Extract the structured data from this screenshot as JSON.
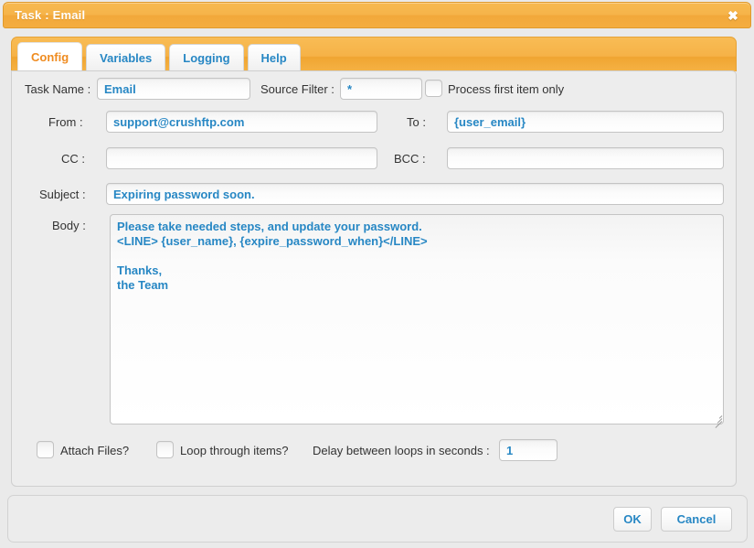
{
  "window": {
    "title": "Task : Email",
    "close_icon": "close-icon",
    "close_glyph": "✖"
  },
  "tabs": [
    {
      "label": "Config",
      "active": true
    },
    {
      "label": "Variables",
      "active": false
    },
    {
      "label": "Logging",
      "active": false
    },
    {
      "label": "Help",
      "active": false
    }
  ],
  "form": {
    "task_name": {
      "label": "Task Name :",
      "value": "Email",
      "placeholder": ""
    },
    "source_filter": {
      "label": "Source Filter :",
      "value": "*",
      "placeholder": ""
    },
    "process_first_item_only": {
      "label": "Process first item only",
      "checked": false
    },
    "from": {
      "label": "From :",
      "value": "support@crushftp.com",
      "placeholder": ""
    },
    "to": {
      "label": "To :",
      "value": "{user_email}",
      "placeholder": ""
    },
    "cc": {
      "label": "CC :",
      "value": "",
      "placeholder": ""
    },
    "bcc": {
      "label": "BCC :",
      "value": "",
      "placeholder": ""
    },
    "subject": {
      "label": "Subject :",
      "value": "Expiring password soon.",
      "placeholder": ""
    },
    "body": {
      "label": "Body :",
      "value": "Please take needed steps, and update your password.\n<LINE> {user_name}, {expire_password_when}</LINE>\n\nThanks,\nthe Team",
      "placeholder": ""
    },
    "attach_files": {
      "label": "Attach Files?",
      "checked": false
    },
    "loop_through_items": {
      "label": "Loop through items?",
      "checked": false
    },
    "delay_between_loops": {
      "label": "Delay between loops in seconds :",
      "value": "1",
      "placeholder": ""
    }
  },
  "footer": {
    "ok_label": "OK",
    "cancel_label": "Cancel"
  },
  "colors": {
    "title_bar_orange": "#f4ad40",
    "active_tab_text": "#ef8b1f",
    "inactive_tab_text": "#2787c4",
    "field_text_blue": "#2787c4",
    "panel_gray": "#ededed"
  }
}
